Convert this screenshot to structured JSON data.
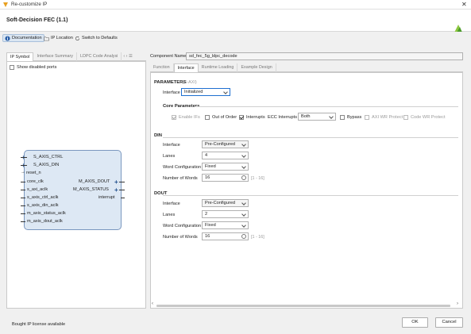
{
  "window": {
    "title": "Re-customize IP"
  },
  "header": {
    "title": "Soft-Decision FEC (1.1)"
  },
  "toolbar": {
    "documentation": "Documentation",
    "ip_location": "IP Location",
    "switch_defaults": "Switch to Defaults"
  },
  "left": {
    "tabs": [
      "IP Symbol",
      "Interface Summary",
      "LDPC Code Analysi"
    ],
    "show_disabled": "Show disabled ports",
    "left_ports": [
      "S_AXIS_CTRL",
      "S_AXIS_DIN",
      "reset_n",
      "core_clk",
      "s_axi_aclk",
      "s_axis_ctrl_aclk",
      "s_axis_din_aclk",
      "m_axis_status_aclk",
      "m_axis_dout_aclk"
    ],
    "right_ports": [
      "M_AXIS_DOUT",
      "M_AXIS_STATUS",
      "interrupt"
    ]
  },
  "right": {
    "component_label": "Component Name",
    "component_value": "sd_fec_5g_ldpc_decode",
    "tabs": [
      "Function",
      "Interface",
      "Runtime Loading",
      "Example Design"
    ],
    "params_title": "PARAMETERS",
    "params_sub": "(S-AXI)",
    "interface_label": "Interface",
    "interface_value": "Initialized",
    "core_params_title": "Core Parameters",
    "enable_irs": "Enable IFs",
    "out_of_order": "Out of Order",
    "interrupts": "Interrupts",
    "ecc_label": "ECC Interrupts",
    "ecc_value": "Both",
    "bypass": "Bypass",
    "xwr_protect": "AXI WR Protect",
    "code_wr_protect": "Code WR Protect",
    "din": {
      "title": "DIN",
      "interface_label": "Interface",
      "interface_value": "Pre-Configured",
      "lanes_label": "Lanes",
      "lanes_value": "4",
      "word_cfg_label": "Word Configuration",
      "word_cfg_value": "Fixed",
      "num_words_label": "Number of Words",
      "num_words_value": "16",
      "range": "[1 - 16]"
    },
    "dout": {
      "title": "DOUT",
      "interface_label": "Interface",
      "interface_value": "Pre-Configured",
      "lanes_label": "Lanes",
      "lanes_value": "2",
      "word_cfg_label": "Word Configuration",
      "word_cfg_value": "Fixed",
      "num_words_label": "Number of Words",
      "num_words_value": "16",
      "range": "[1 - 16]"
    }
  },
  "footer": {
    "license": "Bought IP license available",
    "ok": "OK",
    "cancel": "Cancel"
  }
}
